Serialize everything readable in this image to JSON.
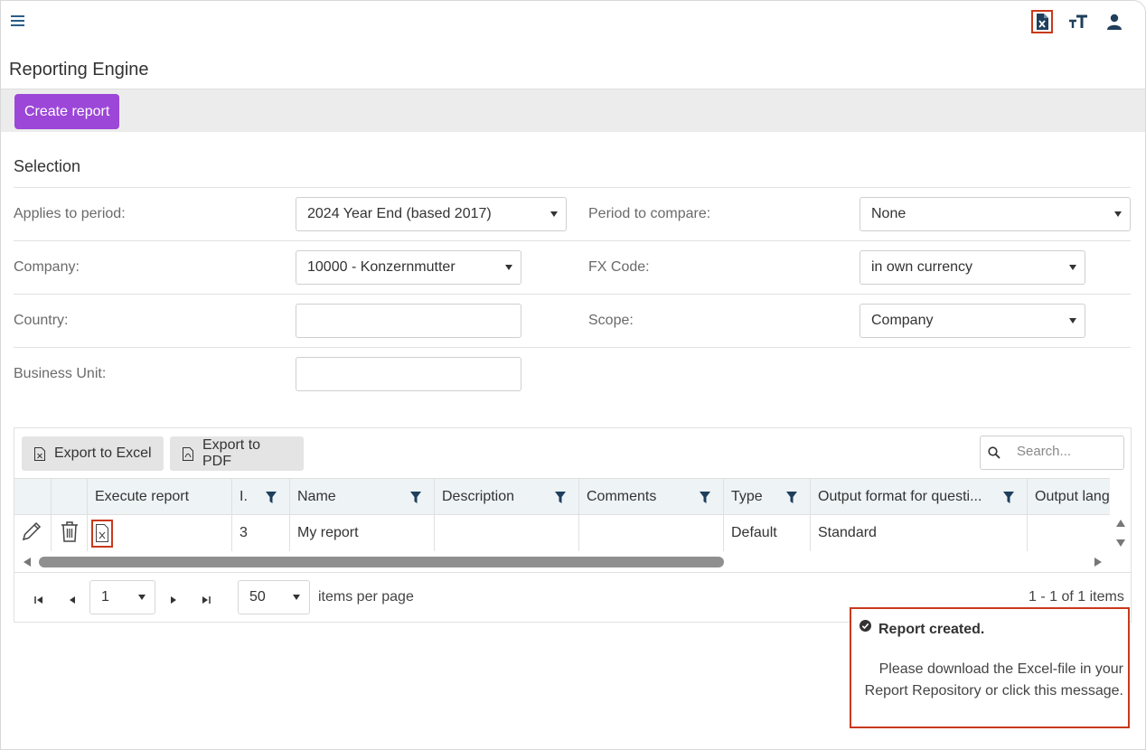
{
  "app": {
    "page_title": "Reporting Engine",
    "create_label": "Create report"
  },
  "selection": {
    "title": "Selection",
    "applies_label": "Applies to period:",
    "applies_value": "2024 Year End (based 2017)",
    "compare_label": "Period to compare:",
    "compare_value": "None",
    "company_label": "Company:",
    "company_value": "10000 - Konzernmutter",
    "fx_label": "FX Code:",
    "fx_value": "in own currency",
    "country_label": "Country:",
    "country_value": "",
    "scope_label": "Scope:",
    "scope_value": "Company",
    "bu_label": "Business Unit:",
    "bu_value": ""
  },
  "grid": {
    "export_excel": "Export to Excel",
    "export_pdf": "Export to PDF",
    "search_placeholder": "Search...",
    "headers": [
      "Execute report",
      "I.",
      "Name",
      "Description",
      "Comments",
      "Type",
      "Output format for questi...",
      "Output lang"
    ],
    "row": {
      "id": "3",
      "name": "My report",
      "description": "",
      "comments": "",
      "type": "Default",
      "output_format": "Standard",
      "output_lang": ""
    }
  },
  "pager": {
    "page": "1",
    "per_page": "50",
    "per_page_label": "items per page",
    "summary": "1 - 1 of 1 items"
  },
  "toast": {
    "title": "Report created.",
    "message": "Please download the Excel-file in your Report Repository or click this message."
  },
  "colors": {
    "accent_purple": "#9c47d8",
    "highlight_red": "#c8391b",
    "icon_blue": "#1f3f5c"
  },
  "icons": [
    "menu-icon",
    "excel-file-icon",
    "font-size-icon",
    "user-icon",
    "edit-icon",
    "trash-icon",
    "filter-icon",
    "search-icon",
    "pdf-file-icon",
    "check-circle-icon"
  ]
}
